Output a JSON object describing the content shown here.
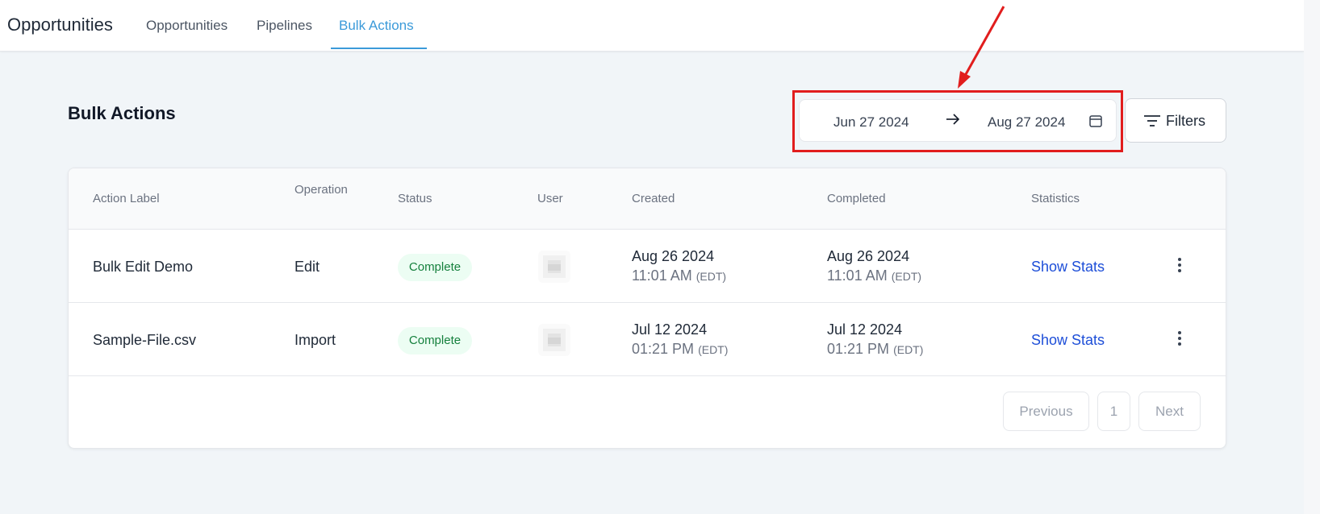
{
  "topbar": {
    "title": "Opportunities",
    "tabs": [
      {
        "label": "Opportunities"
      },
      {
        "label": "Pipelines"
      },
      {
        "label": "Bulk Actions"
      }
    ],
    "active_tab": "Bulk Actions"
  },
  "page": {
    "heading": "Bulk Actions"
  },
  "date_range": {
    "start": "Jun 27 2024",
    "arrow": "→",
    "end": "Aug 27 2024",
    "icon": "calendar-icon"
  },
  "filters": {
    "label": "Filters",
    "icon": "filter-lines-icon"
  },
  "table": {
    "columns": {
      "action_label": "Action Label",
      "operation": "Operation",
      "status": "Status",
      "user": "User",
      "created": "Created",
      "completed": "Completed",
      "statistics": "Statistics"
    },
    "rows": [
      {
        "action_label": "Bulk Edit Demo",
        "operation": "Edit",
        "status": "Complete",
        "created_date": "Aug 26 2024",
        "created_time": "11:01 AM",
        "created_tz": "(EDT)",
        "completed_date": "Aug 26 2024",
        "completed_time": "11:01 AM",
        "completed_tz": "(EDT)",
        "stats_link": "Show Stats"
      },
      {
        "action_label": "Sample-File.csv",
        "operation": "Import",
        "status": "Complete",
        "created_date": "Jul 12 2024",
        "created_time": "01:21 PM",
        "created_tz": "(EDT)",
        "completed_date": "Jul 12 2024",
        "completed_time": "01:21 PM",
        "completed_tz": "(EDT)",
        "stats_link": "Show Stats"
      }
    ]
  },
  "pagination": {
    "previous": "Previous",
    "page": "1",
    "next": "Next"
  },
  "colors": {
    "accent": "#3b9ad9",
    "link": "#1d4ed8",
    "status_bg": "#ecfdf3",
    "status_text": "#15803d",
    "highlight": "#e11d1d"
  }
}
